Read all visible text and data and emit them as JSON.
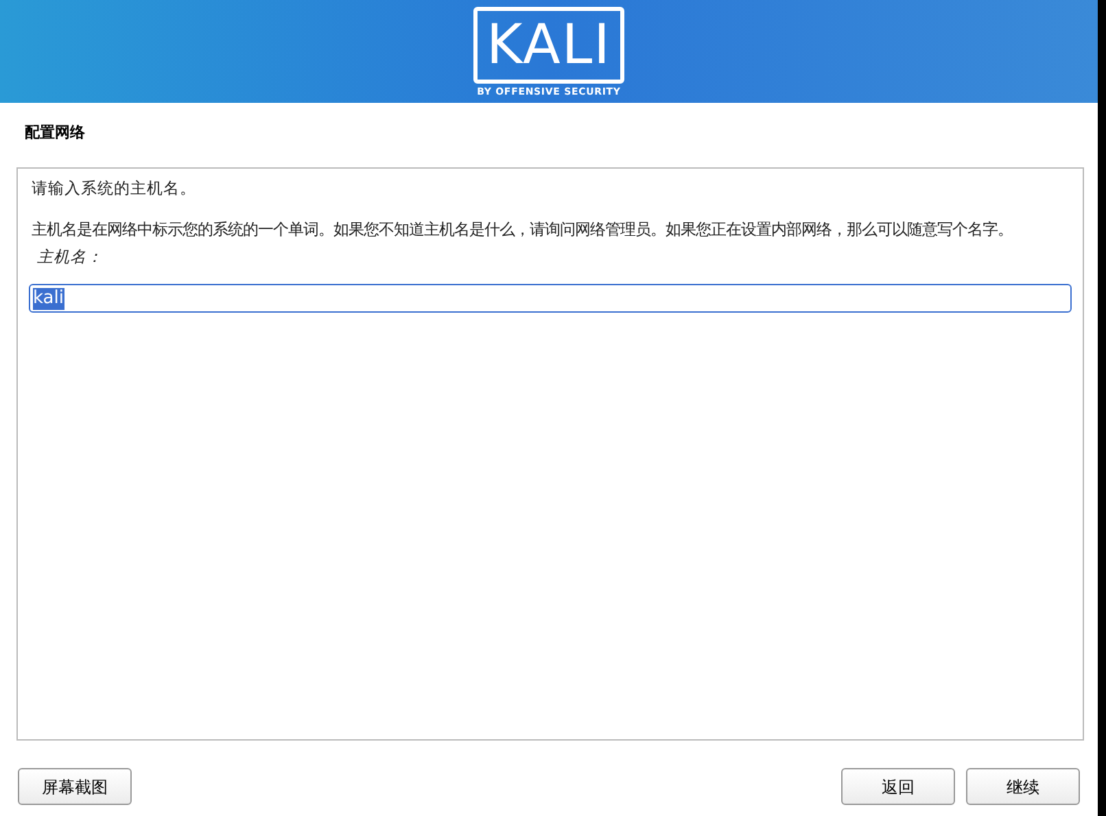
{
  "header": {
    "logo": "KALI",
    "tagline": "BY OFFENSIVE SECURITY"
  },
  "page_title": "配置网络",
  "panel": {
    "prompt": "请输入系统的主机名。",
    "description": "主机名是在网络中标示您的系统的一个单词。如果您不知道主机名是什么，请询问网络管理员。如果您正在设置内部网络，那么可以随意写个名字。",
    "field_label": "主机名：",
    "field": {
      "value": "kali",
      "text_selected": true
    }
  },
  "buttons": [
    {
      "label": "屏幕截图"
    },
    {
      "label": "返回"
    },
    {
      "label": "继续"
    }
  ]
}
